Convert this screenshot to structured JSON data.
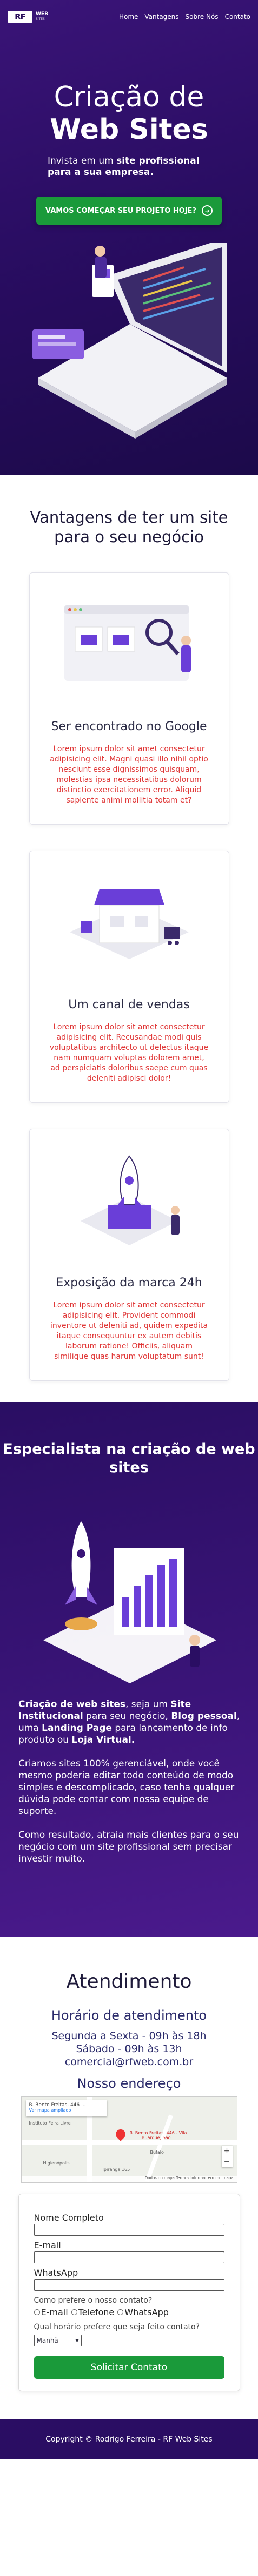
{
  "header": {
    "logo_mark": "RF",
    "logo_text": "WEB",
    "logo_sub": "SITES",
    "nav": [
      "Home",
      "Vantagens",
      "Sobre Nós",
      "Contato"
    ]
  },
  "hero": {
    "title_light": "Criação de",
    "title_bold": "Web Sites",
    "subtitle_prefix": "Invista em um ",
    "subtitle_bold": "site profissional para a sua empresa.",
    "cta_label": "VAMOS COMEÇAR SEU PROJETO HOJE?"
  },
  "advantages": {
    "title": "Vantagens de ter um site para o seu negócio",
    "cards": [
      {
        "title": "Ser encontrado no Google",
        "text": "Lorem ipsum dolor sit amet consectetur adipisicing elit. Magni quasi illo nihil optio nesciunt esse dignissimos quisquam, molestias ipsa necessitatibus dolorum distinctio exercitationem error. Aliquid sapiente animi mollitia totam et?"
      },
      {
        "title": "Um canal de vendas",
        "text": "Lorem ipsum dolor sit amet consectetur adipisicing elit. Recusandae modi quis voluptatibus architecto ut delectus itaque nam numquam voluptas dolorem amet, ad perspiciatis doloribus saepe cum quas deleniti adipisci dolor!"
      },
      {
        "title": "Exposição da marca 24h",
        "text": "Lorem ipsum dolor sit amet consectetur adipisicing elit. Provident commodi inventore ut deleniti ad, quidem expedita itaque consequuntur ex autem debitis laborum ratione! Officiis, aliquam similique quas harum voluptatum sunt!"
      }
    ]
  },
  "specialist": {
    "title": "Especialista na criação de web sites",
    "p1_b1": "Criação de web sites",
    "p1_t1": ", seja um ",
    "p1_b2": "Site Institucional",
    "p1_t2": " para seu negócio, ",
    "p1_b3": "Blog pessoal",
    "p1_t3": ", uma ",
    "p1_b4": "Landing Page",
    "p1_t4": " para lançamento de info produto ou ",
    "p1_b5": "Loja Virtual.",
    "p2": "Criamos sites 100% gerenciável, onde você mesmo poderia editar todo conteúdo de modo simples e descomplicado, caso tenha qualquer dúvida pode contar com nossa equipe de suporte.",
    "p3": "Como resultado, atraia mais clientes para o seu negócio com um site profissional sem precisar investir muito."
  },
  "atendimento": {
    "title": "Atendimento",
    "hours_title": "Horário de atendimento",
    "hours_line1": "Segunda a Sexta - 09h às 18h",
    "hours_line2": "Sábado - 09h às 13h",
    "email": "comercial@rfweb.com.br",
    "address_title": "Nosso endereço"
  },
  "map": {
    "place": "R. Bento Freitas, 446 ...",
    "link": "Ver mapa ampliado",
    "pin_label": "R. Bento Freitas, 446 - Vila Buarque, São...",
    "labels": [
      "Instituto Feira Livre",
      "Bufalo",
      "Higienópolis",
      "Ipiranga 165"
    ],
    "footer": "Dados do mapa  Termos  Informar erro no mapa"
  },
  "form": {
    "name_label": "Nome Completo",
    "email_label": "E-mail",
    "whatsapp_label": "WhatsApp",
    "contact_question": "Como prefere o nosso contato?",
    "contact_options": [
      "E-mail",
      "Telefone",
      "WhatsApp"
    ],
    "time_question": "Qual horário prefere que seja feito contato?",
    "time_selected": "Manhã",
    "submit_label": "Solicitar Contato"
  },
  "footer": {
    "text": "Copyright © Rodrigo Ferreira - RF Web Sites"
  }
}
